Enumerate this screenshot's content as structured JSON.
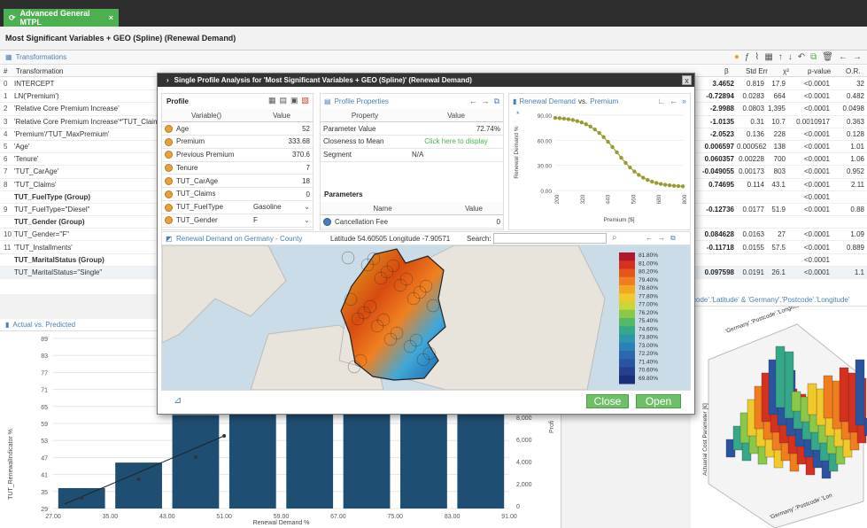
{
  "app": {
    "tab_label": "Advanced General MTPL",
    "tab_close": "×",
    "model_title": "Most Significant Variables + GEO (Spline) (Renewal Demand)"
  },
  "transformations": {
    "header": "Transformations",
    "col_transformation": "Transformation",
    "col_hash": "#",
    "col_coef": "β",
    "col_stderr": "Std Err",
    "col_chi": "χ²",
    "col_p": "p-value",
    "col_or": "O.R.",
    "rows": [
      {
        "idx": "0",
        "name": "INTERCEPT",
        "group": false,
        "coef": "3.4652",
        "se": "0.819",
        "x2": "17.9",
        "p": "<0.0001",
        "or": "32"
      },
      {
        "idx": "1",
        "name": "LN('Premium')",
        "group": false,
        "coef": "-0.72894",
        "se": "0.0283",
        "x2": "664",
        "p": "<0.0001",
        "or": "0.482"
      },
      {
        "idx": "2",
        "name": "'Relative Core Premium Increase'",
        "group": false,
        "coef": "-2.9988",
        "se": "0.0803",
        "x2": "1,395",
        "p": "<0.0001",
        "or": "0.0498"
      },
      {
        "idx": "3",
        "name": "'Relative Core Premium Increase'*'TUT_Claims'",
        "group": false,
        "coef": "-1.0135",
        "se": "0.31",
        "x2": "10.7",
        "p": "0.0010917",
        "or": "0.363"
      },
      {
        "idx": "4",
        "name": "'Premium'/'TUT_MaxPremium'",
        "group": false,
        "coef": "-2.0523",
        "se": "0.136",
        "x2": "228",
        "p": "<0.0001",
        "or": "0.128"
      },
      {
        "idx": "5",
        "name": "'Age'",
        "group": false,
        "coef": "0.006597",
        "se": "0.000562",
        "x2": "138",
        "p": "<0.0001",
        "or": "1.01"
      },
      {
        "idx": "6",
        "name": "'Tenure'",
        "group": false,
        "coef": "0.060357",
        "se": "0.00228",
        "x2": "700",
        "p": "<0.0001",
        "or": "1.06"
      },
      {
        "idx": "7",
        "name": "'TUT_CarAge'",
        "group": false,
        "coef": "-0.049055",
        "se": "0.00173",
        "x2": "803",
        "p": "<0.0001",
        "or": "0.952"
      },
      {
        "idx": "8",
        "name": "'TUT_Claims'",
        "group": false,
        "coef": "0.74695",
        "se": "0.114",
        "x2": "43.1",
        "p": "<0.0001",
        "or": "2.11"
      },
      {
        "idx": "",
        "name": "TUT_FuelType (Group)",
        "group": true,
        "coef": "",
        "se": "",
        "x2": "",
        "p": "<0.0001",
        "or": ""
      },
      {
        "idx": "9",
        "name": "TUT_FuelType=\"Diesel\"",
        "group": false,
        "coef": "-0.12736",
        "se": "0.0177",
        "x2": "51.9",
        "p": "<0.0001",
        "or": "0.88"
      },
      {
        "idx": "",
        "name": "TUT_Gender (Group)",
        "group": true,
        "coef": "",
        "se": "",
        "x2": "",
        "p": "",
        "or": ""
      },
      {
        "idx": "10",
        "name": "TUT_Gender=\"F\"",
        "group": false,
        "coef": "0.084628",
        "se": "0.0163",
        "x2": "27",
        "p": "<0.0001",
        "or": "1.09"
      },
      {
        "idx": "11",
        "name": "'TUT_Installments'",
        "group": false,
        "coef": "-0.11718",
        "se": "0.0155",
        "x2": "57.5",
        "p": "<0.0001",
        "or": "0.889"
      },
      {
        "idx": "",
        "name": "TUT_MaritalStatus (Group)",
        "group": true,
        "coef": "",
        "se": "",
        "x2": "",
        "p": "<0.0001",
        "or": ""
      },
      {
        "idx": "",
        "name": "TUT_MaritalStatus=\"Single\"",
        "group": false,
        "coef": "0.097598",
        "se": "0.0191",
        "x2": "26.1",
        "p": "<0.0001",
        "or": "1.1"
      }
    ]
  },
  "dialog": {
    "title": "Single Profile Analysis for 'Most Significant Variables + GEO (Spline)' (Renewal Demand)",
    "close_label": "x",
    "profile": {
      "title": "Profile",
      "col_variable": "Variable()",
      "col_value": "Value",
      "rows": [
        {
          "var": "Age",
          "value": "52"
        },
        {
          "var": "Premium",
          "value": "333.68"
        },
        {
          "var": "Previous Premium",
          "value": "370.6"
        },
        {
          "var": "Tenure",
          "value": "7"
        },
        {
          "var": "TUT_CarAge",
          "value": "18"
        },
        {
          "var": "TUT_Claims",
          "value": "0"
        },
        {
          "var": "TUT_FuelType",
          "value": "Gasoline"
        },
        {
          "var": "TUT_Gender",
          "value": "F"
        }
      ]
    },
    "properties": {
      "header": "Profile Properties",
      "col_property": "Property",
      "col_value": "Value",
      "rows": [
        {
          "prop": "Parameter Value",
          "value": "72.74%"
        },
        {
          "prop": "Closeness to Mean",
          "value": "Click here to display"
        },
        {
          "prop": "Segment",
          "value": "N/A"
        }
      ],
      "params_title": "Parameters",
      "params_col_name": "Name",
      "params_col_value": "Value",
      "params_first": "Cancellation Fee",
      "params_first_value": "0"
    },
    "curve_chart": {
      "header_y": "Renewal Demand",
      "header_vs": "vs.",
      "header_x": "Premium",
      "ylabel": "Renewal Demand %",
      "xlabel": "Premium [$]",
      "yticks": [
        "90.00",
        "60.00",
        "30.00",
        "0.00"
      ],
      "xticks": [
        "200",
        "320",
        "440",
        "560",
        "680",
        "800"
      ]
    },
    "map": {
      "header": "Renewal Demand on Germany - County",
      "coords_label": "Latitude 54.60505 Longitude -7.90571",
      "search_label": "Search:",
      "search_value": "",
      "legend": [
        "81.80%",
        "81.00%",
        "80.20%",
        "79.40%",
        "78.60%",
        "77.80%",
        "77.00%",
        "76.20%",
        "75.40%",
        "74.60%",
        "73.80%",
        "73.00%",
        "72.20%",
        "71.40%",
        "70.60%",
        "69.80%"
      ]
    },
    "close_button": "Close",
    "open_button": "Open"
  },
  "actual_chart": {
    "header": "Actual vs. Predicted",
    "ylabel": "TUT_RenewalIndicator %",
    "xlabel": "Renewal Demand %",
    "right_axis_ticks": [
      "8,000",
      "6,000",
      "4,000",
      "2,000",
      "0"
    ],
    "right_axis_label": "Profi",
    "chart_data": {
      "type": "bar",
      "x": [
        "27.00",
        "35.00",
        "43.00",
        "51.00",
        "59.00",
        "67.00",
        "75.00",
        "83.00",
        "91.00"
      ],
      "yticks": [
        "89",
        "83",
        "77",
        "71",
        "65",
        "59",
        "53",
        "47",
        "41",
        "35",
        "29"
      ],
      "ylim": [
        29,
        89
      ]
    }
  },
  "surface_chart": {
    "header": "code'.'Latitude' & 'Germany'.'Postcode'.'Longitude'",
    "top_label": "'Germany'.'Postcode'.'Longitude'",
    "zlabel": "Actuarial Cost Parameter [€]",
    "bottom_label": "'Germany'.'Postcode'.'Lon"
  },
  "colors": {
    "accent": "#4caf50",
    "dark_bar": "#1f4e73"
  }
}
